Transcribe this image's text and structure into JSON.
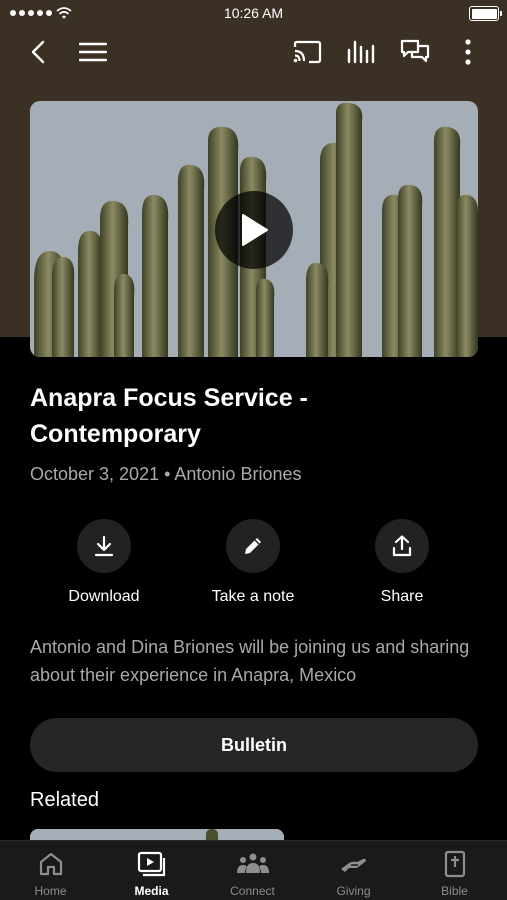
{
  "status_bar": {
    "time": "10:26 AM"
  },
  "nav": {
    "icons": [
      "back-chevron-icon",
      "menu-icon",
      "cast-icon",
      "audio-icon",
      "chat-icon",
      "more-icon"
    ]
  },
  "media": {
    "title": "Anapra Focus Service - Contemporary",
    "meta": "October 3, 2021 • Antonio Briones",
    "actions": [
      {
        "label": "Download",
        "icon": "download-icon"
      },
      {
        "label": "Take a note",
        "icon": "pencil-icon"
      },
      {
        "label": "Share",
        "icon": "share-icon"
      }
    ],
    "description": "Antonio and Dina Briones will be joining us and sharing about their experience in Anapra, Mexico",
    "bulletin_label": "Bulletin",
    "related_heading": "Related"
  },
  "tabs": [
    {
      "label": "Home",
      "icon": "home-icon",
      "active": false
    },
    {
      "label": "Media",
      "icon": "media-icon",
      "active": true
    },
    {
      "label": "Connect",
      "icon": "connect-icon",
      "active": false
    },
    {
      "label": "Giving",
      "icon": "giving-icon",
      "active": false
    },
    {
      "label": "Bible",
      "icon": "bible-icon",
      "active": false
    }
  ],
  "colors": {
    "background": "#000000",
    "header_brown": "#3a3124",
    "surface": "#262626",
    "muted_text": "#a9a9a9",
    "tab_bar": "#1a1a1a"
  }
}
